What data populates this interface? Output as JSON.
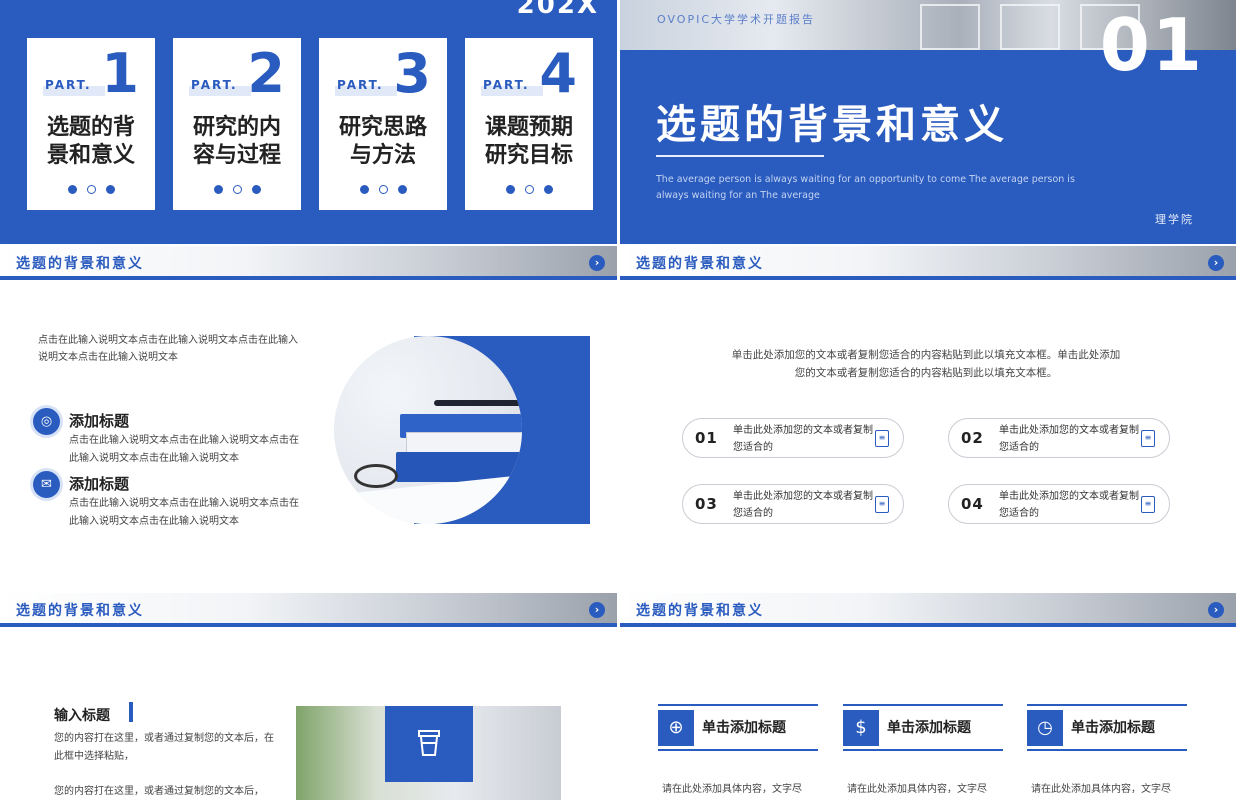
{
  "slide1": {
    "year": "202X",
    "parts": [
      {
        "label": "PART.",
        "num": "1",
        "title": "选题的背\n景和意义"
      },
      {
        "label": "PART.",
        "num": "2",
        "title": "研究的内\n容与过程"
      },
      {
        "label": "PART.",
        "num": "3",
        "title": "研究思路\n与方法"
      },
      {
        "label": "PART.",
        "num": "4",
        "title": "课题预期\n研究目标"
      }
    ]
  },
  "slide2": {
    "header": "OVOPIC大学学术开题报告",
    "number": "01",
    "title": "选题的背景和意义",
    "english": "The average person is always waiting for an opportunity to come The average person is always waiting for an The average",
    "college": "理学院"
  },
  "section_title": "选题的背景和意义",
  "slide3": {
    "intro": "点击在此输入说明文本点击在此输入说明文本点击在此输入说明文本点击在此输入说明文本",
    "items": [
      {
        "icon": "target-icon",
        "title": "添加标题",
        "text": "点击在此输入说明文本点击在此输入说明文本点击在此输入说明文本点击在此输入说明文本"
      },
      {
        "icon": "mail-icon",
        "title": "添加标题",
        "text": "点击在此输入说明文本点击在此输入说明文本点击在此输入说明文本点击在此输入说明文本"
      }
    ]
  },
  "slide4": {
    "intro": "单击此处添加您的文本或者复制您适合的内容粘贴到此以填充文本框。单击此处添加您的文本或者复制您适合的内容粘贴到此以填充文本框。",
    "pills": [
      {
        "num": "01",
        "text": "单击此处添加您的文本或者复制您适合的"
      },
      {
        "num": "02",
        "text": "单击此处添加您的文本或者复制您适合的"
      },
      {
        "num": "03",
        "text": "单击此处添加您的文本或者复制您适合的"
      },
      {
        "num": "04",
        "text": "单击此处添加您的文本或者复制您适合的"
      }
    ]
  },
  "slide5": {
    "title": "输入标题",
    "text1": "您的内容打在这里，或者通过复制您的文本后，在此框中选择粘贴，",
    "text2": "您的内容打在这里，或者通过复制您的文本后，"
  },
  "slide6": {
    "columns": [
      {
        "icon": "lifebuoy-icon",
        "title": "单击添加标题",
        "text": "请在此处添加具体内容，文字尽"
      },
      {
        "icon": "coins-icon",
        "title": "单击添加标题",
        "text": "请在此处添加具体内容，文字尽"
      },
      {
        "icon": "clock-icon",
        "title": "单击添加标题",
        "text": "请在此处添加具体内容，文字尽"
      }
    ]
  },
  "colors": {
    "accent": "#2a5bbf",
    "light_accent": "#e1e9f8"
  }
}
